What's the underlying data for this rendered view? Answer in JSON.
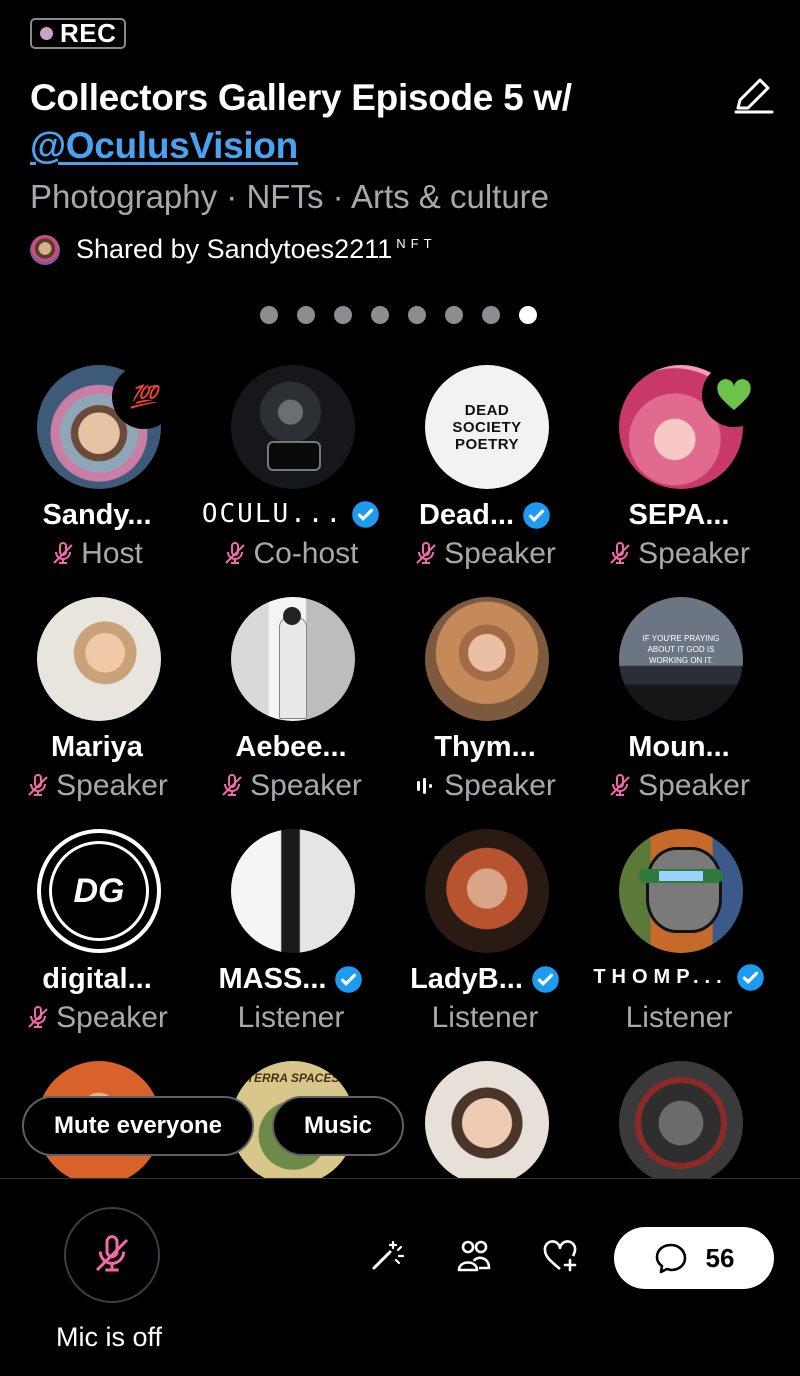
{
  "rec_label": "REC",
  "title_text": "Collectors Gallery Episode 5 w/",
  "title_handle": "@OculusVision",
  "topics": "Photography · NFTs · Arts & culture",
  "shared_by": "Shared by Sandytoes2211",
  "shared_by_suffix": "NFT",
  "pager": {
    "count": 8,
    "active_index": 7
  },
  "participants": [
    {
      "name": "Sandy...",
      "role": "Host",
      "verified": false,
      "mic_off": true,
      "reaction": "💯",
      "avatar_icon": "woman-flowers-avatar"
    },
    {
      "name": "OCULU...",
      "role": "Co-host",
      "verified": true,
      "mic_off": true,
      "avatar_icon": "photographer-camera-avatar"
    },
    {
      "name": "Dead...",
      "role": "Speaker",
      "verified": true,
      "mic_off": true,
      "avatar_text": "DEAD SOCIETY POETRY",
      "avatar_icon": "dead-society-poetry-logo"
    },
    {
      "name": "SEPA...",
      "role": "Speaker",
      "verified": false,
      "mic_off": true,
      "reaction": "💚",
      "avatar_icon": "pink-art-avatar"
    },
    {
      "name": "Mariya",
      "role": "Speaker",
      "verified": false,
      "mic_off": true,
      "avatar_icon": "woman-portrait-avatar"
    },
    {
      "name": "Aebee...",
      "role": "Speaker",
      "verified": false,
      "mic_off": true,
      "avatar_icon": "man-bw-avatar"
    },
    {
      "name": "Thym...",
      "role": "Speaker",
      "verified": false,
      "mic_off": false,
      "speaking": true,
      "avatar_icon": "woman-sunglasses-avatar"
    },
    {
      "name": "Moun...",
      "role": "Speaker",
      "verified": false,
      "mic_off": true,
      "avatar_text": "IF YOU'RE PRAYING ABOUT IT GOD IS WORKING ON IT.",
      "avatar_icon": "mountain-quote-avatar"
    },
    {
      "name": "digital...",
      "role": "Speaker",
      "verified": false,
      "mic_off": true,
      "avatar_text": "DG",
      "avatar_icon": "dg-logo-avatar"
    },
    {
      "name": "MASS...",
      "role": "Listener",
      "verified": true,
      "mic_off": false,
      "avatar_icon": "bw-figure-avatar"
    },
    {
      "name": "LadyB...",
      "role": "Listener",
      "verified": true,
      "mic_off": false,
      "avatar_icon": "redhead-avatar"
    },
    {
      "name": "THOMP...",
      "role": "Listener",
      "verified": true,
      "mic_off": false,
      "avatar_icon": "headphones-cartoon-avatar"
    }
  ],
  "partial_row_icons": [
    "orange-person-avatar",
    "terra-spaces-avatar",
    "glasses-woman-avatar",
    "mask-art-avatar"
  ],
  "partial_row_text": "TERRA SPACES",
  "mute_everyone_label": "Mute everyone",
  "music_label": "Music",
  "mic_status_label": "Mic is off",
  "comment_count": "56",
  "colors": {
    "mic_off_pink": "#f06aa8",
    "verified_blue": "#1d9bf0",
    "link_blue": "#4aa3f0",
    "secondary_text": "#a7a9ad"
  }
}
